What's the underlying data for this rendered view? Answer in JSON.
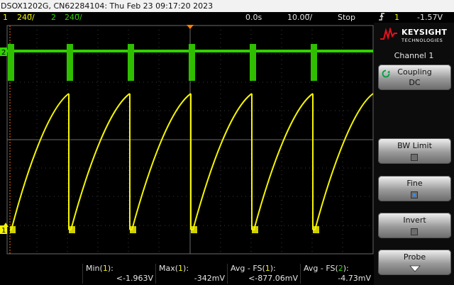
{
  "title_bar": {
    "text": "DSOX1202G, CN62284104: Thu Feb 23 09:17:20 2023"
  },
  "status": {
    "ch1_num": "1",
    "ch1_scale": "240̅/",
    "ch2_num": "2",
    "ch2_scale": "240̅/",
    "time_delay": "0.0s",
    "time_scale": "10.00̅/",
    "run_state": "Stop",
    "trigger_icon": "trigger-edge-icon",
    "trigger_source": "1",
    "trigger_level": "-1.57V"
  },
  "right_panel": {
    "brand": "KEYSIGHT",
    "brand_sub": "TECHNOLOGIES",
    "title": "Channel 1",
    "softkeys": [
      {
        "label": "Coupling",
        "value": "DC"
      },
      {
        "label": "BW Limit",
        "checked": false
      },
      {
        "label": "Fine",
        "checked": true
      },
      {
        "label": "Invert",
        "checked": false
      },
      {
        "label": "Probe"
      }
    ]
  },
  "measurements": [
    {
      "name": "Min",
      "src": "1",
      "value": "<-1.963V"
    },
    {
      "name": "Max",
      "src": "1",
      "value": "-342mV"
    },
    {
      "name": "Avg - FS",
      "src": "1",
      "value": "<-877.06mV"
    },
    {
      "name": "Avg - FS",
      "src": "2",
      "value": "-4.73mV"
    }
  ],
  "colors": {
    "ch1": "#f5f500",
    "ch2": "#33d000",
    "accent": "#ff8000",
    "trigger": "#ff6a00"
  }
}
